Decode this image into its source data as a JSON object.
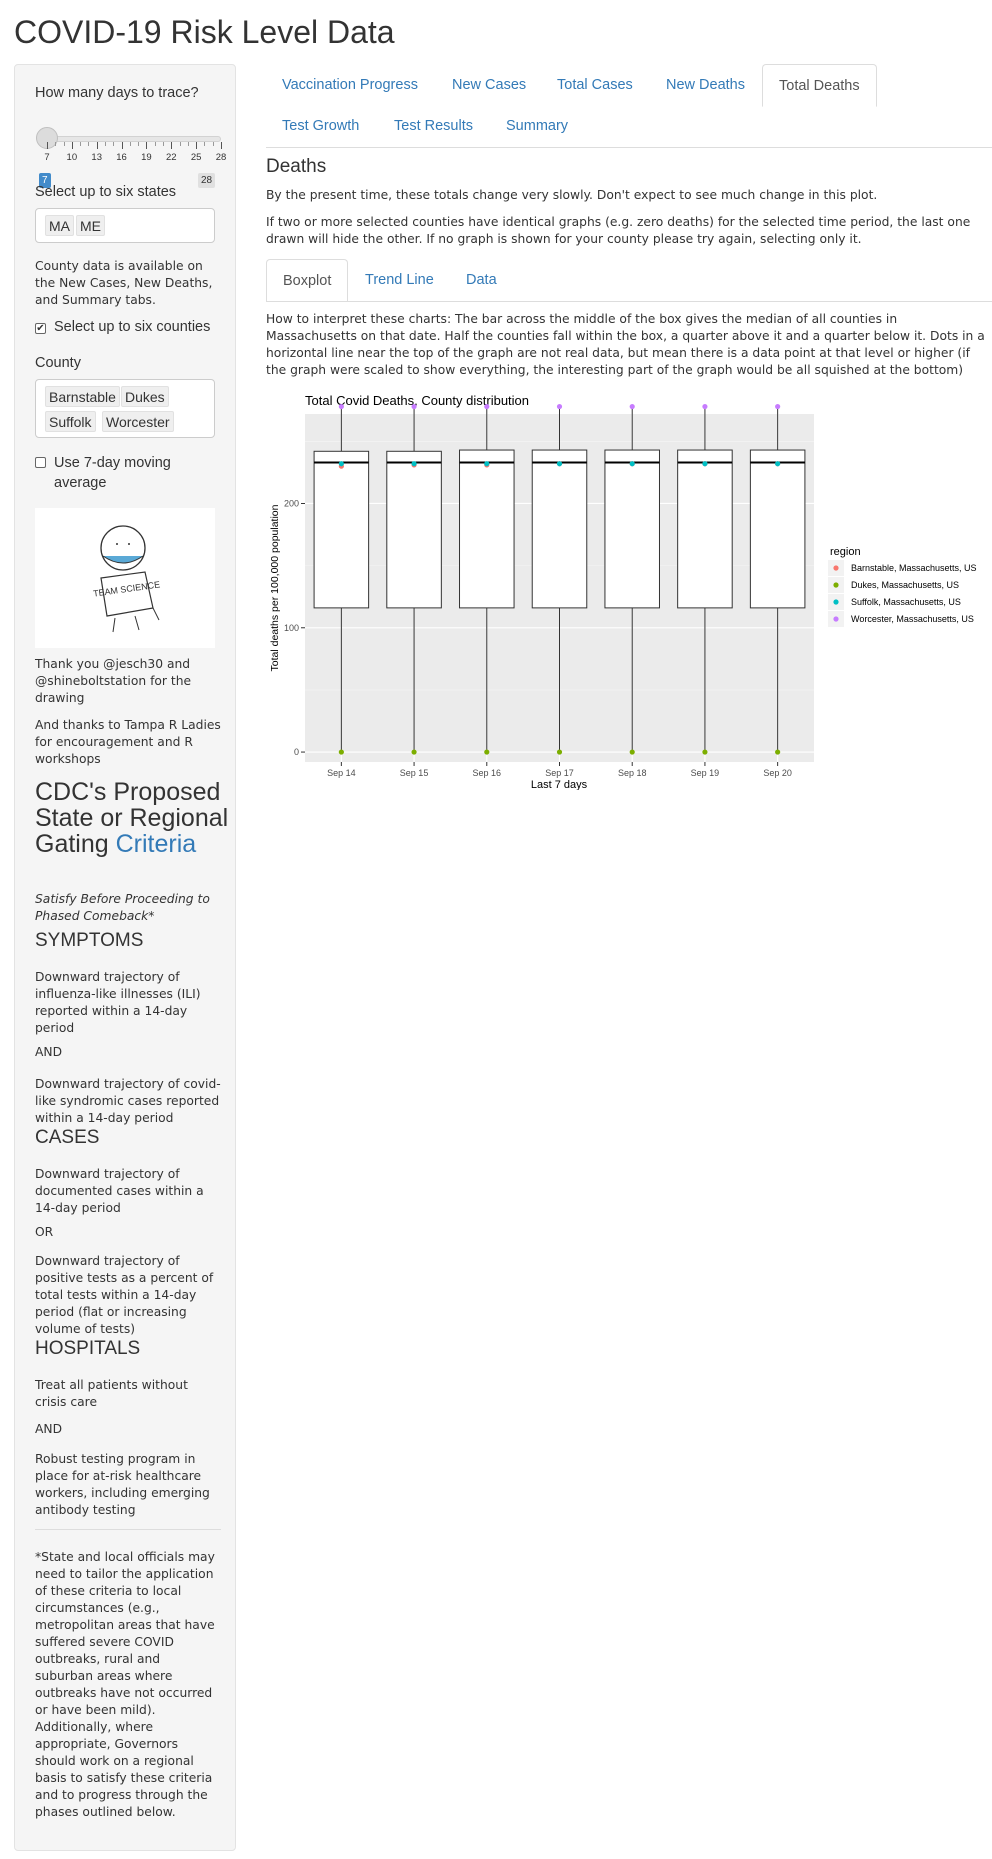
{
  "app_title": "COVID-19 Risk Level Data",
  "sidebar": {
    "days_label": "How many days to trace?",
    "days_value": "7",
    "days_max": "28",
    "days_ticks": [
      "7",
      "10",
      "13",
      "16",
      "19",
      "22",
      "25",
      "28"
    ],
    "states_label": "Select up to six states",
    "states_selected": [
      "MA",
      "ME"
    ],
    "county_note": "County data is available on the New Cases, New Deaths, and Summary tabs.",
    "counties_checkbox_label": "Select up to six counties",
    "counties_checkbox_checked": true,
    "county_label": "County",
    "counties_selected": [
      "Barnstable",
      "Dukes",
      "Suffolk",
      "Worcester"
    ],
    "moving_avg_label": "Use 7-day moving average",
    "moving_avg_checked": false,
    "drawing_sign_text": "TEAM SCIENCE",
    "thanks_1": "Thank you @jesch30 and @shineboltstation for the drawing",
    "thanks_2": "And thanks to Tampa R Ladies for encouragement and R workshops",
    "cdc_title_prefix": "CDC's Proposed State or Regional Gating ",
    "cdc_title_link": "Criteria",
    "cdc_subtitle": "Satisfy Before Proceeding to Phased Comeback*",
    "symptoms_heading": "SYMPTOMS",
    "symptoms_1": "Downward trajectory of influenza-like illnesses (ILI) reported within a 14-day period",
    "and_1": "AND",
    "symptoms_2": "Downward trajectory of covid-like syndromic cases reported within a 14-day period",
    "cases_heading": "CASES",
    "cases_1": "Downward trajectory of documented cases within a 14-day period",
    "or_1": "OR",
    "cases_2": "Downward trajectory of positive tests as a percent of total tests within a 14-day period (flat or increasing volume of tests)",
    "hospitals_heading": "HOSPITALS",
    "hospitals_1": "Treat all patients without crisis care",
    "and_2": "AND",
    "hospitals_2": "Robust testing program in place for at-risk healthcare workers, including emerging antibody testing",
    "footnote": "*State and local officials may need to tailor the application of these criteria to local circumstances (e.g., metropolitan areas that have suffered severe COVID outbreaks, rural and suburban areas where outbreaks have not occurred or have been mild). Additionally, where appropriate, Governors should work on a regional basis to satisfy these criteria and to progress through the phases outlined below."
  },
  "main": {
    "tabs_row1": [
      "Vaccination Progress",
      "New Cases",
      "Total Cases",
      "New Deaths",
      "Total Deaths"
    ],
    "tabs_row2": [
      "Test Growth",
      "Test Results",
      "Summary"
    ],
    "active_tab": "Total Deaths",
    "section_title": "Deaths",
    "para_1": "By the present time, these totals change very slowly. Don't expect to see much change in this plot.",
    "para_2": "If two or more selected counties have identical graphs (e.g. zero deaths) for the selected time period, the last one drawn will hide the other. If no graph is shown for your county please try again, selecting only it.",
    "subtabs": [
      "Boxplot",
      "Trend Line",
      "Data"
    ],
    "active_subtab": "Boxplot",
    "interpretation": "How to interpret these charts: The bar across the middle of the box gives the median of all counties in Massachusetts on that date. Half the counties fall within the box, a quarter above it and a quarter below it. Dots in a horizontal line near the top of the graph are not real data, but mean there is a data point at that level or higher (if the graph were scaled to show everything, the interesting part of the graph would be all squished at the bottom)"
  },
  "chart_data": {
    "type": "boxplot",
    "title": "Total Covid Deaths, County distribution",
    "xlabel": "Last 7 days",
    "ylabel": "Total deaths per 100,000 population",
    "categories": [
      "Sep 14",
      "Sep 15",
      "Sep 16",
      "Sep 17",
      "Sep 18",
      "Sep 19",
      "Sep 20"
    ],
    "ylim": [
      -8,
      272
    ],
    "yticks": [
      0,
      100,
      200
    ],
    "boxes": [
      {
        "x": "Sep 14",
        "low": 0,
        "q1": 116,
        "median": 233,
        "q3": 242,
        "high": 278
      },
      {
        "x": "Sep 15",
        "low": 0,
        "q1": 116,
        "median": 233,
        "q3": 242,
        "high": 278
      },
      {
        "x": "Sep 16",
        "low": 0,
        "q1": 116,
        "median": 233,
        "q3": 243,
        "high": 278
      },
      {
        "x": "Sep 17",
        "low": 0,
        "q1": 116,
        "median": 233,
        "q3": 243,
        "high": 278
      },
      {
        "x": "Sep 18",
        "low": 0,
        "q1": 116,
        "median": 233,
        "q3": 243,
        "high": 278
      },
      {
        "x": "Sep 19",
        "low": 0,
        "q1": 116,
        "median": 233,
        "q3": 243,
        "high": 278
      },
      {
        "x": "Sep 20",
        "low": 0,
        "q1": 116,
        "median": 233,
        "q3": 243,
        "high": 278
      }
    ],
    "legend_title": "region",
    "legend_position": "right",
    "series": [
      {
        "name": "Barnstable, Massachusetts, US",
        "color": "#F8766D",
        "values": [
          230,
          231,
          231,
          232,
          232,
          232,
          232
        ]
      },
      {
        "name": "Dukes, Massachusetts, US",
        "color": "#7CAE00",
        "values": [
          0,
          0,
          0,
          0,
          0,
          0,
          0
        ]
      },
      {
        "name": "Suffolk, Massachusetts, US",
        "color": "#00BFC4",
        "values": [
          232,
          232,
          232,
          232,
          232,
          232,
          232
        ]
      },
      {
        "name": "Worcester, Massachusetts, US",
        "color": "#C77CFF",
        "values": [
          278,
          278,
          278,
          278,
          278,
          278,
          278
        ]
      }
    ],
    "grid": true,
    "panel_color": "#EBEBEB"
  }
}
